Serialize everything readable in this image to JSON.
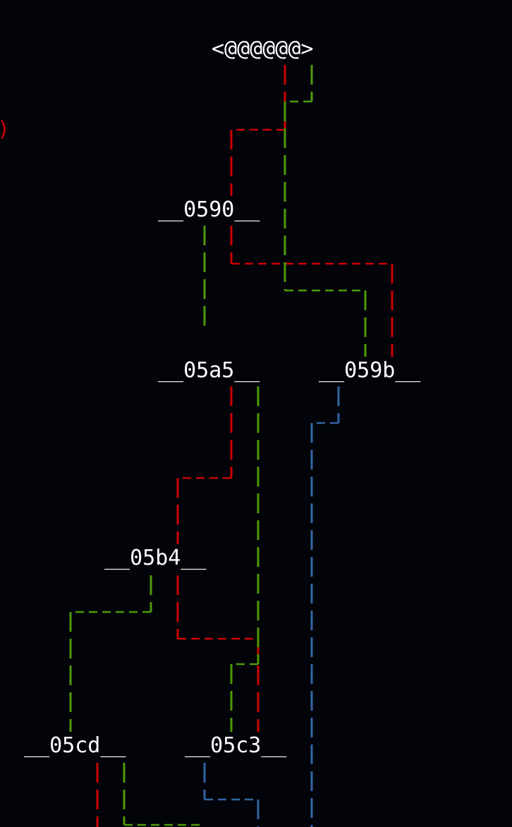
{
  "diagram": {
    "root_label": "<@@@@@@>",
    "edge_mark": ")",
    "nodes": [
      {
        "id": "n0590",
        "label": "__0590__"
      },
      {
        "id": "n05a5",
        "label": "__05a5__"
      },
      {
        "id": "n059b",
        "label": "__059b__"
      },
      {
        "id": "n05b4",
        "label": "__05b4__"
      },
      {
        "id": "n05cd",
        "label": "__05cd__"
      },
      {
        "id": "n05c3",
        "label": "__05c3__"
      }
    ],
    "colors": {
      "background": "#02040a",
      "text": "#ffffff",
      "red": "#cc0000",
      "green": "#4e9a06",
      "blue": "#3465a4"
    }
  }
}
